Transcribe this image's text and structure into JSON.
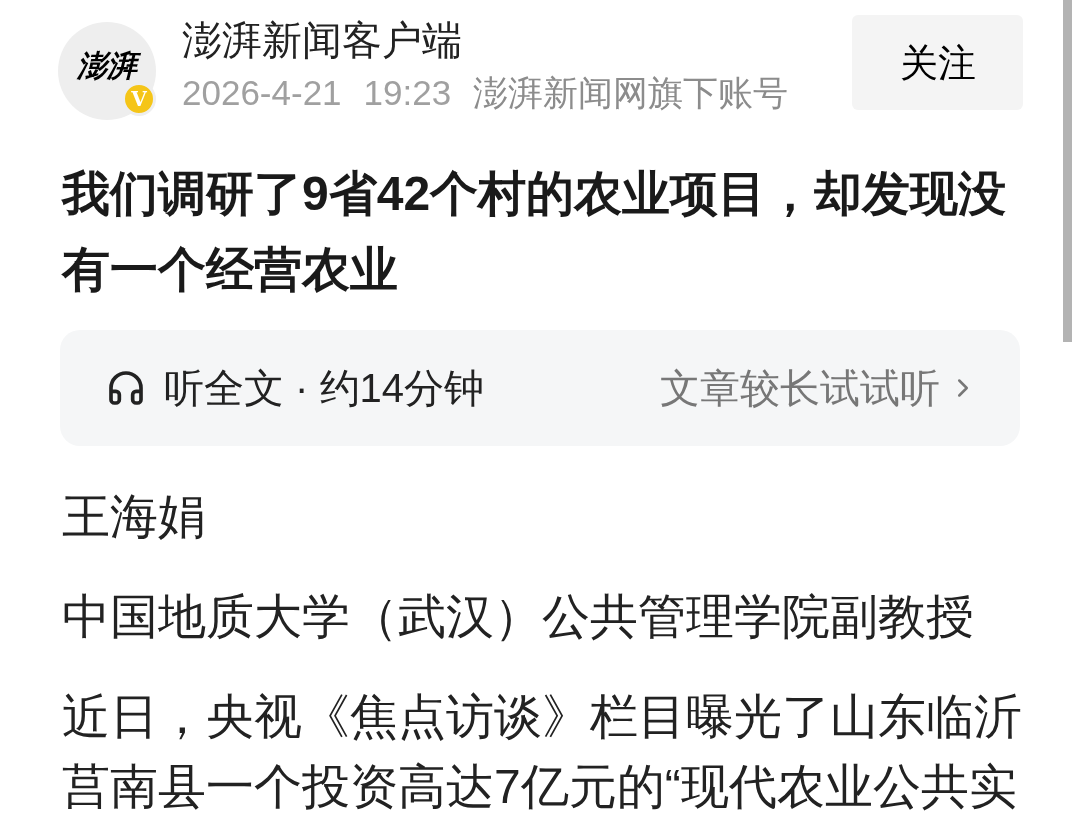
{
  "account": {
    "avatar_text": "澎湃",
    "badge": "V",
    "name": "澎湃新闻客户端",
    "date": "2026-4-21",
    "time": "19:23",
    "source": "澎湃新闻网旗下账号"
  },
  "follow_button": {
    "label": "关注"
  },
  "article": {
    "title": "我们调研了9省42个村的农业项目，却发现没有一个经营农业",
    "listen": {
      "label": "听全文 · 约14分钟",
      "hint": "文章较长试试听"
    },
    "author": "王海娟",
    "affiliation": "中国地质大学（武汉）公共管理学院副教授",
    "paragraphs": [
      "近日，央视《焦点访谈》栏目曝光了山东临沂莒南县一个投资高达7亿元的“现代农业公共实"
    ]
  }
}
